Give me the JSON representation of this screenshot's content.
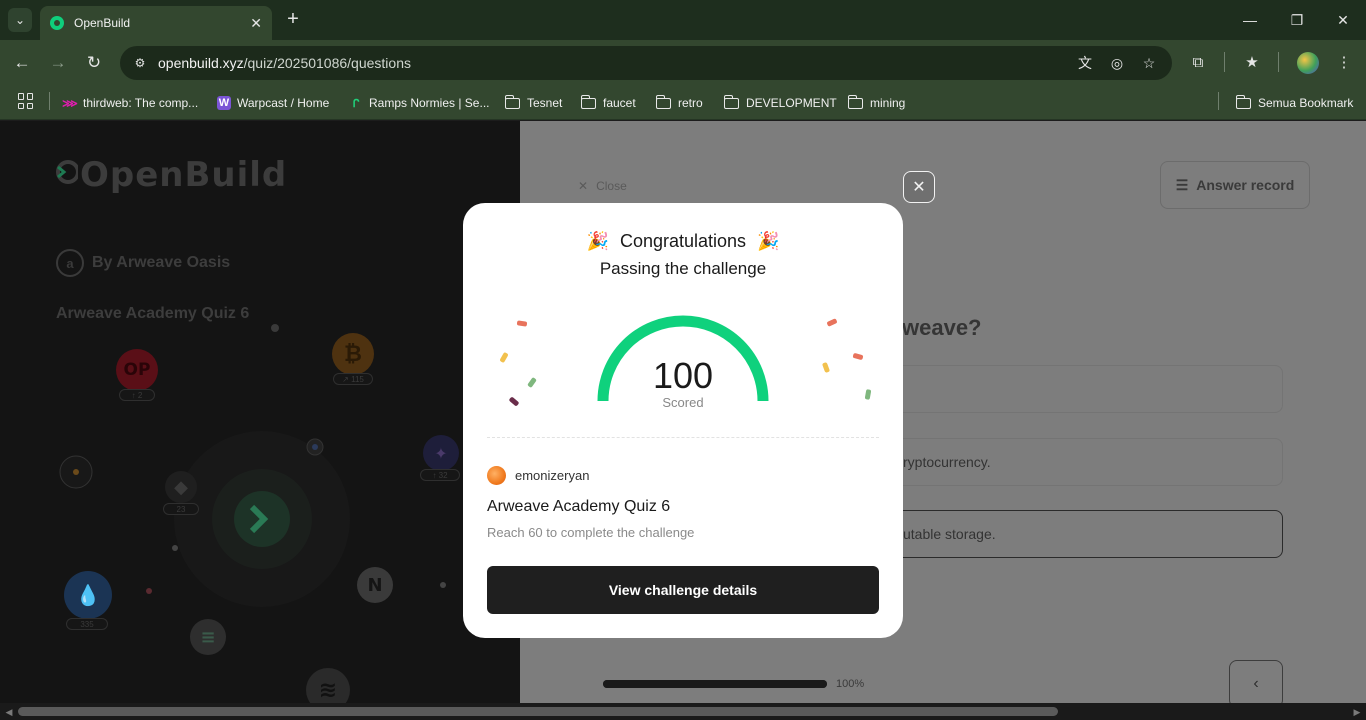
{
  "browser": {
    "tab_title": "OpenBuild",
    "url_host": "openbuild.xyz",
    "url_path": "/quiz/202501086/questions",
    "bookmarks": [
      {
        "label": "thirdweb: The comp...",
        "icon": "thirdweb-icon"
      },
      {
        "label": "Warpcast / Home",
        "icon": "warpcast-icon"
      },
      {
        "label": "Ramps Normies | Se...",
        "icon": "ramps-icon"
      },
      {
        "label": "Tesnet",
        "icon": "folder-icon"
      },
      {
        "label": "faucet",
        "icon": "folder-icon"
      },
      {
        "label": "retro",
        "icon": "folder-icon"
      },
      {
        "label": "DEVELOPMENT",
        "icon": "folder-icon"
      },
      {
        "label": "mining",
        "icon": "folder-icon"
      }
    ],
    "all_bookmarks_label": "Semua Bookmark"
  },
  "left": {
    "brand": "OpenBuild",
    "byline": "By Arweave Oasis",
    "quiz_title": "Arweave Academy Quiz 6",
    "coins": [
      {
        "name": "op-coin",
        "label": "OP",
        "badge": "↑ 2"
      },
      {
        "name": "bitcoin-coin",
        "label": "₿",
        "badge": "↗ 115"
      },
      {
        "name": "ethereum-coin",
        "label": "◆",
        "badge": "23"
      },
      {
        "name": "starknet-coin",
        "label": "✦",
        "badge": "↑ 32"
      },
      {
        "name": "sui-coin",
        "label": "💧",
        "badge": "335"
      },
      {
        "name": "near-coin",
        "label": "N"
      },
      {
        "name": "solana-coin",
        "label": "≡"
      },
      {
        "name": "aptos-coin",
        "label": "≋"
      }
    ]
  },
  "right": {
    "close_label": "Close",
    "answer_record_label": "Answer record",
    "question_fragment": "weave?",
    "options": [
      "",
      "ryptocurrency.",
      "utable storage."
    ],
    "progress_percent": 100,
    "progress_label": "100%",
    "prev_icon": "‹"
  },
  "modal": {
    "heading": "Congratulations",
    "party_icon": "🎉",
    "subheading": "Passing the challenge",
    "score": "100",
    "score_label": "Scored",
    "username": "emonizeryan",
    "quiz_title": "Arweave Academy Quiz 6",
    "requirement": "Reach 60 to complete the challenge",
    "button_label": "View challenge details",
    "gauge_color": "#0fd17d"
  }
}
